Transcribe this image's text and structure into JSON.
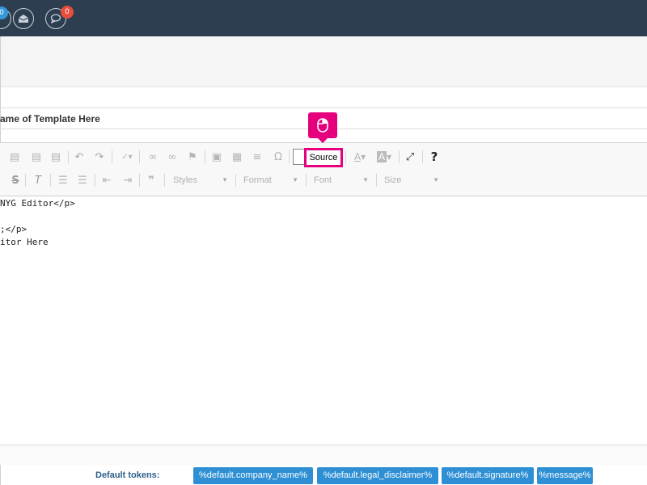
{
  "topbar": {
    "badge_left": "0",
    "badge_chat": "0",
    "icons": [
      "user-icon",
      "envelope-icon",
      "chat-icon"
    ]
  },
  "template_name": {
    "value": "ame of Template Here"
  },
  "toolbar": {
    "source_label": "Source",
    "styles_label": "Styles",
    "format_label": "Format",
    "font_label": "Font",
    "size_label": "Size",
    "help_label": "?"
  },
  "editor": {
    "lines": [
      "NYG Editor</p>",
      "",
      ";</p>",
      "itor Here"
    ]
  },
  "tokens": {
    "label": "Default tokens:",
    "items": [
      "%default.company_name%",
      "%default.legal_disclaimer%",
      "%default.signature%",
      "%message%"
    ]
  },
  "colors": {
    "topbar": "#2c3e50",
    "accent_pink": "#e6007e",
    "token_blue": "#2e8fd4",
    "badge_red": "#e74c3c"
  }
}
